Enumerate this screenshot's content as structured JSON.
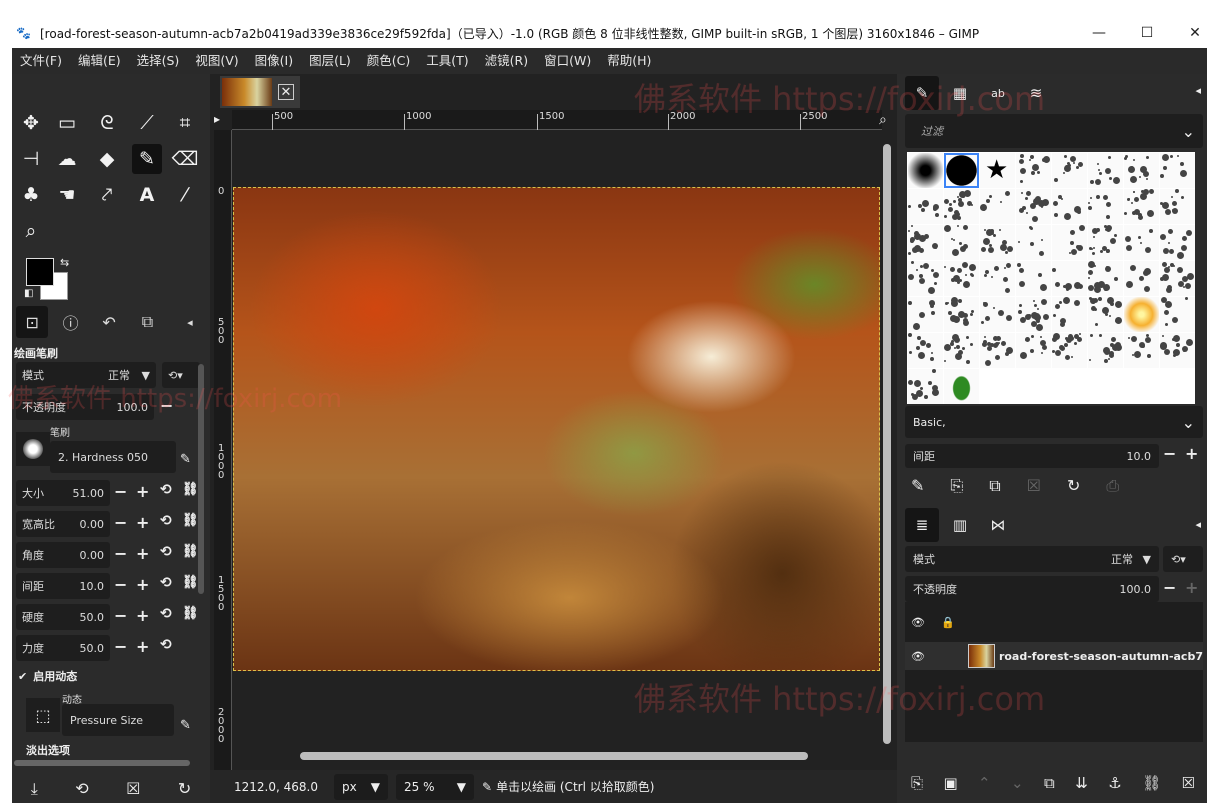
{
  "window": {
    "title": "[road-forest-season-autumn-acb7a2b0419ad339e3836ce29f592fda]（已导入）-1.0 (RGB 颜色 8 位非线性整数, GIMP built-in sRGB, 1 个图层) 3160x1846 – GIMP",
    "minimize": "—",
    "maximize": "☐",
    "close": "✕"
  },
  "menu": [
    "文件(F)",
    "编辑(E)",
    "选择(S)",
    "视图(V)",
    "图像(I)",
    "图层(L)",
    "颜色(C)",
    "工具(T)",
    "滤镜(R)",
    "窗口(W)",
    "帮助(H)"
  ],
  "toolbox": {
    "panel_title": "绘画笔刷",
    "mode_label": "模式",
    "mode_value": "正常",
    "opacity_label": "不透明度",
    "opacity_value": "100.0",
    "brush_label": "笔刷",
    "brush_name": "2. Hardness 050",
    "size_label": "大小",
    "size_value": "51.00",
    "aspect_label": "宽高比",
    "aspect_value": "0.00",
    "angle_label": "角度",
    "angle_value": "0.00",
    "spacing_label": "间距",
    "spacing_value": "10.0",
    "hardness_label": "硬度",
    "hardness_value": "50.0",
    "force_label": "力度",
    "force_value": "50.0",
    "dynamics_enable": "启用动态",
    "dynamics_label": "动态",
    "dynamics_name": "Pressure Size",
    "fade_label": "淡出选项"
  },
  "ruler": {
    "top": [
      "500",
      "1000",
      "1500",
      "2000",
      "2500"
    ],
    "left": [
      "0",
      "5\n0\n0",
      "1\n0\n0\n0",
      "1\n5\n0\n0",
      "2\n0\n0\n0"
    ]
  },
  "status": {
    "coords": "1212.0, 468.0",
    "unit": "px",
    "zoom": "25 %",
    "message": "单击以绘画 (Ctrl 以拾取颜色)"
  },
  "right_dock": {
    "filter_placeholder": "过滤",
    "preset": "Basic,",
    "spacing_label": "间距",
    "spacing_value": "10.0",
    "layers_mode_label": "模式",
    "layers_mode_value": "正常",
    "layers_opacity_label": "不透明度",
    "layers_opacity_value": "100.0",
    "layer_name": "road-forest-season-autumn-acb7"
  },
  "watermark": [
    "佛系软件 https://foxirj.com",
    "佛系软件 https://foxirj.com",
    "佛系软件 https://foxirj.com"
  ]
}
